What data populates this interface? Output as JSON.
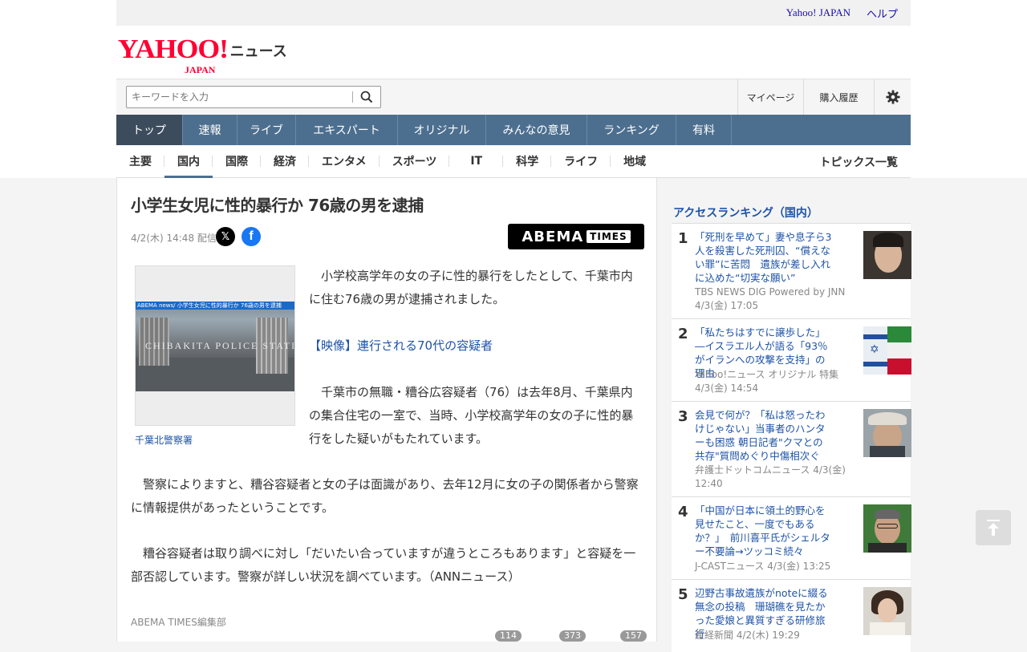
{
  "utility_links": {
    "yahoo_japan": "Yahoo! JAPAN",
    "help": "ヘルプ"
  },
  "logo": {
    "wordmark": "YAHOO!",
    "sub": "JAPAN",
    "service": "ニュース"
  },
  "search": {
    "placeholder": "キーワードを入力"
  },
  "account_links": {
    "mypage": "マイページ",
    "history": "購入履歴"
  },
  "main_nav": [
    {
      "label": "トップ",
      "active": true
    },
    {
      "label": "速報"
    },
    {
      "label": "ライブ"
    },
    {
      "label": "エキスパート"
    },
    {
      "label": "オリジナル"
    },
    {
      "label": "みんなの意見"
    },
    {
      "label": "ランキング"
    },
    {
      "label": "有料"
    }
  ],
  "sub_nav": [
    {
      "label": "主要"
    },
    {
      "label": "国内",
      "active": true
    },
    {
      "label": "国際"
    },
    {
      "label": "経済"
    },
    {
      "label": "エンタメ"
    },
    {
      "label": "スポーツ"
    },
    {
      "label": "IT"
    },
    {
      "label": "科学"
    },
    {
      "label": "ライフ"
    },
    {
      "label": "地域"
    }
  ],
  "topics_link": "トピックス一覧",
  "article": {
    "title": "小学生女児に性的暴行か 76歳の男を逮捕",
    "date": "4/2(木) 14:48 配信",
    "publisher_logo": {
      "main": "ABEMA",
      "sub": "TIMES"
    },
    "photo_banner": "ABEMA news/ 小学生女児に性的暴行か 76歳の男を逮捕",
    "photo_sign": "CHIBAKITA POLICE STATION",
    "photo_caption": "千葉北警察署",
    "p1": "　小学校高学年の女の子に性的暴行をしたとして、千葉市内に住む76歳の男が逮捕されました。",
    "video_link": "【映像】連行される70代の容疑者",
    "p2": "　千葉市の無職・糟谷広容疑者（76）は去年8月、千葉県内の集合住宅の一室で、当時、小学校高学年の女の子に性的暴行をした疑いがもたれています。",
    "p3": "　警察によりますと、糟谷容疑者と女の子は面識があり、去年12月に女の子の関係者から警察に情報提供があったということです。",
    "p4": "　糟谷容疑者は取り調べに対し「だいたい合っていますが違うところもあります」と容疑を一部否認しています。警察が詳しい状況を調べています。（ANNニュース）",
    "byline": "ABEMA TIMES編集部",
    "counts": [
      "114",
      "373",
      "157"
    ]
  },
  "ranking": {
    "title": "アクセスランキング（国内）",
    "items": [
      {
        "rank": "1",
        "headline": "「死刑を早めて」妻や息子ら3人を殺害した死刑囚、“償えない罪”に苦悶　遺族が差し入れに込めた“切実な願い”",
        "source": "TBS NEWS DIG Powered by JNN",
        "time": "4/3(金) 17:05",
        "thumb": "portrait"
      },
      {
        "rank": "2",
        "headline": "「私たちはすでに譲歩した」―イスラエル人が語る「93％がイランへの攻撃を支持」の理由",
        "source": "Yahoo!ニュース オリジナル 特集",
        "time": "4/3(金) 14:54",
        "thumb": "flags"
      },
      {
        "rank": "3",
        "headline": "会見で何が？「私は怒ったわけじゃない」当事者のハンターも困惑 朝日記者\"クマとの共存\"質問めぐり中傷相次ぐ",
        "source": "弁護士ドットコムニュース 4/3(金)",
        "time": "12:40",
        "thumb": "hat"
      },
      {
        "rank": "4",
        "headline": "「中国が日本に領土的野心を見せたこと、一度でもあるか？」　前川喜平氏がシェルター不要論→ツッコミ続々",
        "source": "J-CASTニュース 4/3(金) 13:25",
        "time": "",
        "thumb": "glasses"
      },
      {
        "rank": "5",
        "headline": "辺野古事故遺族がnoteに綴る無念の投稿　珊瑚礁を見たかった愛娘と異質すぎる研修旅行",
        "source": "産経新聞 4/2(木) 19:29",
        "time": "",
        "thumb": "girl"
      }
    ]
  }
}
